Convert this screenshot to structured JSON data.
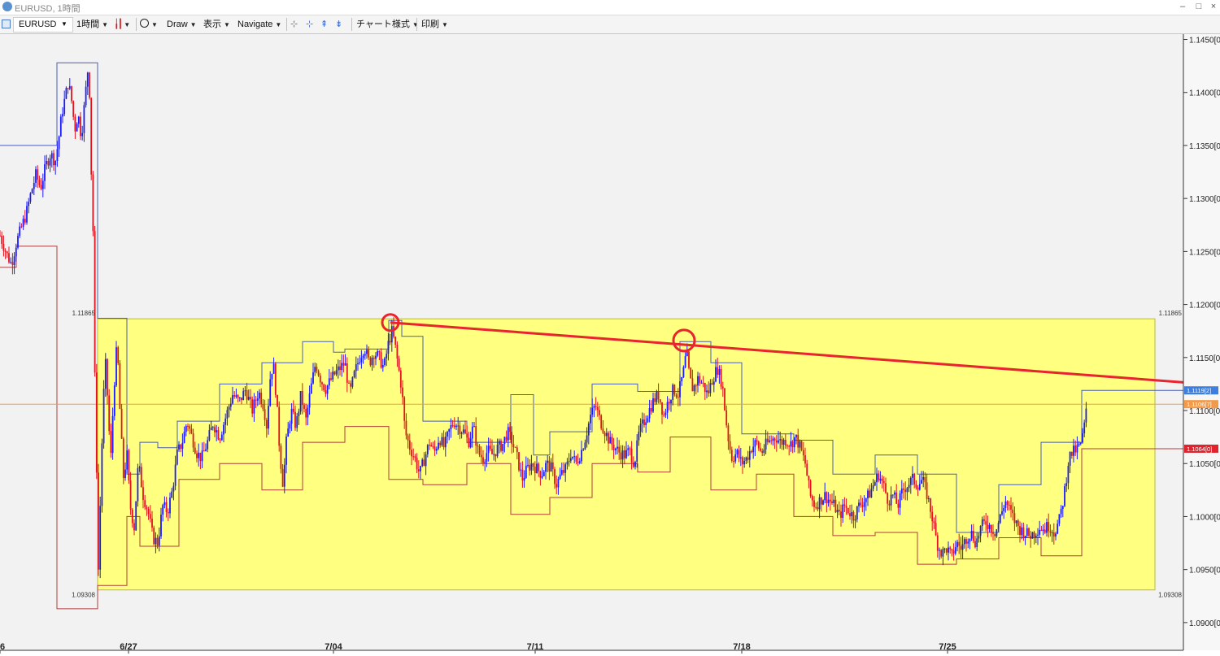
{
  "window": {
    "title": "EURUSD, 1時間"
  },
  "toolbar": {
    "symbol": "EURUSD",
    "timeframe": "1時間",
    "draw": "Draw",
    "display": "表示",
    "navigate": "Navigate",
    "chart_style": "チャート様式",
    "print": "印刷"
  },
  "colors": {
    "bull": "#1a1aff",
    "bear": "#e0141e",
    "range_box": "#ffff80",
    "trendline": "#e8242e",
    "current_price_line": "#f29a4a",
    "tag_blue": "#3d7fe0",
    "tag_orange": "#f29a4a",
    "tag_red": "#e0232d"
  },
  "chart_data": {
    "type": "candlestick",
    "symbol": "EURUSD",
    "timeframe": "1時間",
    "ylim": [
      1.0893,
      1.1455
    ],
    "y_ticks": [
      "1.1450[0]",
      "1.1400[0]",
      "1.1350[0]",
      "1.1300[0]",
      "1.1250[0]",
      "1.1200[0]",
      "1.1150[0]",
      "1.1100[0]",
      "1.1050[0]",
      "1.1000[0]",
      "1.0950[0]",
      "1.0900[0]"
    ],
    "x_ticks": [
      "6",
      "6/27",
      "7/04",
      "7/11",
      "7/18",
      "7/25"
    ],
    "range_box": {
      "upper": 1.11865,
      "lower": 1.09308,
      "upper_label": "1.11865",
      "lower_label": "1.09308"
    },
    "price_tags": [
      {
        "label": "1.1119[2]",
        "value": 1.1119,
        "color": "blue"
      },
      {
        "label": "1.1106[7]",
        "value": 1.1106,
        "color": "orange"
      },
      {
        "label": "1.1064[0]",
        "value": 1.1064,
        "color": "red"
      }
    ],
    "trendline": {
      "from": {
        "date": "7/06",
        "price": 1.1183
      },
      "to": {
        "date": "7/29",
        "price": 1.1124
      }
    },
    "circled_highs": [
      {
        "date": "7/06",
        "price": 1.1183
      },
      {
        "date": "7/15",
        "price": 1.1166
      }
    ],
    "current_price": 1.1106,
    "path": [
      [
        0,
        1.1265
      ],
      [
        8,
        1.1248
      ],
      [
        14,
        1.1238
      ],
      [
        20,
        1.1258
      ],
      [
        26,
        1.1272
      ],
      [
        32,
        1.1285
      ],
      [
        38,
        1.1305
      ],
      [
        44,
        1.1322
      ],
      [
        50,
        1.131
      ],
      [
        56,
        1.133
      ],
      [
        62,
        1.1342
      ],
      [
        68,
        1.1335
      ],
      [
        72,
        1.1355
      ],
      [
        76,
        1.138
      ],
      [
        80,
        1.1395
      ],
      [
        84,
        1.141
      ],
      [
        88,
        1.1392
      ],
      [
        92,
        1.1365
      ],
      [
        96,
        1.138
      ],
      [
        100,
        1.1358
      ],
      [
        104,
        1.139
      ],
      [
        108,
        1.1422
      ],
      [
        110,
        1.14
      ],
      [
        112,
        1.133
      ],
      [
        115,
        1.1255
      ],
      [
        117,
        1.11
      ],
      [
        119,
        1.104
      ],
      [
        121,
        1.095
      ],
      [
        123,
        1.1005
      ],
      [
        125,
        1.106
      ],
      [
        127,
        1.111
      ],
      [
        130,
        1.1145
      ],
      [
        133,
        1.11
      ],
      [
        136,
        1.105
      ],
      [
        140,
        1.112
      ],
      [
        144,
        1.1165
      ],
      [
        148,
        1.109
      ],
      [
        152,
        1.1035
      ],
      [
        156,
        1.106
      ],
      [
        160,
        1.101
      ],
      [
        165,
        1.099
      ],
      [
        170,
        1.105
      ],
      [
        176,
        1.102
      ],
      [
        182,
        1.1005
      ],
      [
        188,
        1.098
      ],
      [
        194,
        1.0975
      ],
      [
        200,
        1.101
      ],
      [
        206,
        1.1005
      ],
      [
        212,
        1.1025
      ],
      [
        218,
        1.106
      ],
      [
        224,
        1.107
      ],
      [
        230,
        1.109
      ],
      [
        236,
        1.1075
      ],
      [
        242,
        1.106
      ],
      [
        248,
        1.1055
      ],
      [
        255,
        1.107
      ],
      [
        262,
        1.1088
      ],
      [
        270,
        1.1075
      ],
      [
        278,
        1.1095
      ],
      [
        286,
        1.1115
      ],
      [
        294,
        1.1108
      ],
      [
        302,
        1.112
      ],
      [
        310,
        1.11
      ],
      [
        318,
        1.1118
      ],
      [
        324,
        1.1105
      ],
      [
        328,
        1.1085
      ],
      [
        332,
        1.113
      ],
      [
        336,
        1.1145
      ],
      [
        340,
        1.111
      ],
      [
        344,
        1.106
      ],
      [
        348,
        1.103
      ],
      [
        352,
        1.107
      ],
      [
        358,
        1.11
      ],
      [
        364,
        1.1085
      ],
      [
        370,
        1.1115
      ],
      [
        376,
        1.109
      ],
      [
        382,
        1.112
      ],
      [
        388,
        1.1145
      ],
      [
        394,
        1.113
      ],
      [
        400,
        1.112
      ],
      [
        406,
        1.1128
      ],
      [
        412,
        1.1135
      ],
      [
        418,
        1.114
      ],
      [
        424,
        1.1145
      ],
      [
        430,
        1.1115
      ],
      [
        436,
        1.1135
      ],
      [
        442,
        1.115
      ],
      [
        448,
        1.116
      ],
      [
        454,
        1.1145
      ],
      [
        460,
        1.1155
      ],
      [
        466,
        1.115
      ],
      [
        472,
        1.114
      ],
      [
        478,
        1.1165
      ],
      [
        482,
        1.1175
      ],
      [
        486,
        1.116
      ],
      [
        490,
        1.114
      ],
      [
        494,
        1.112
      ],
      [
        498,
        1.108
      ],
      [
        504,
        1.1065
      ],
      [
        510,
        1.1055
      ],
      [
        516,
        1.104
      ],
      [
        522,
        1.1055
      ],
      [
        528,
        1.107
      ],
      [
        534,
        1.106
      ],
      [
        540,
        1.1075
      ],
      [
        546,
        1.1065
      ],
      [
        552,
        1.108
      ],
      [
        558,
        1.109
      ],
      [
        564,
        1.1085
      ],
      [
        570,
        1.108
      ],
      [
        576,
        1.107
      ],
      [
        582,
        1.1085
      ],
      [
        588,
        1.106
      ],
      [
        594,
        1.1055
      ],
      [
        600,
        1.1062
      ],
      [
        606,
        1.1058
      ],
      [
        612,
        1.1065
      ],
      [
        618,
        1.1068
      ],
      [
        624,
        1.108
      ],
      [
        630,
        1.107
      ],
      [
        636,
        1.1055
      ],
      [
        642,
        1.1035
      ],
      [
        648,
        1.1045
      ],
      [
        654,
        1.105
      ],
      [
        660,
        1.1045
      ],
      [
        666,
        1.104
      ],
      [
        672,
        1.105
      ],
      [
        678,
        1.1045
      ],
      [
        684,
        1.103
      ],
      [
        690,
        1.104
      ],
      [
        696,
        1.1045
      ],
      [
        702,
        1.106
      ],
      [
        708,
        1.105
      ],
      [
        714,
        1.106
      ],
      [
        720,
        1.1075
      ],
      [
        726,
        1.1095
      ],
      [
        732,
        1.1105
      ],
      [
        738,
        1.109
      ],
      [
        744,
        1.108
      ],
      [
        750,
        1.107
      ],
      [
        756,
        1.1065
      ],
      [
        762,
        1.106
      ],
      [
        768,
        1.1058
      ],
      [
        774,
        1.1062
      ],
      [
        780,
        1.105
      ],
      [
        786,
        1.108
      ],
      [
        792,
        1.109
      ],
      [
        798,
        1.11
      ],
      [
        804,
        1.111
      ],
      [
        810,
        1.1115
      ],
      [
        816,
        1.1095
      ],
      [
        822,
        1.111
      ],
      [
        828,
        1.112
      ],
      [
        834,
        1.1115
      ],
      [
        840,
        1.1135
      ],
      [
        844,
        1.1155
      ],
      [
        848,
        1.113
      ],
      [
        852,
        1.112
      ],
      [
        858,
        1.113
      ],
      [
        864,
        1.1125
      ],
      [
        870,
        1.1115
      ],
      [
        876,
        1.113
      ],
      [
        882,
        1.114
      ],
      [
        888,
        1.1125
      ],
      [
        892,
        1.1095
      ],
      [
        896,
        1.107
      ],
      [
        900,
        1.1055
      ],
      [
        906,
        1.106
      ],
      [
        912,
        1.105
      ],
      [
        918,
        1.1055
      ],
      [
        924,
        1.1065
      ],
      [
        930,
        1.107
      ],
      [
        936,
        1.106
      ],
      [
        942,
        1.1068
      ],
      [
        948,
        1.1072
      ],
      [
        954,
        1.1075
      ],
      [
        960,
        1.107
      ],
      [
        966,
        1.1072
      ],
      [
        972,
        1.1068
      ],
      [
        978,
        1.1075
      ],
      [
        984,
        1.1065
      ],
      [
        990,
        1.105
      ],
      [
        996,
        1.102
      ],
      [
        1002,
        1.101
      ],
      [
        1008,
        1.1015
      ],
      [
        1014,
        1.102
      ],
      [
        1020,
        1.1015
      ],
      [
        1026,
        1.101
      ],
      [
        1032,
        1.1
      ],
      [
        1038,
        1.101
      ],
      [
        1044,
        1.1005
      ],
      [
        1050,
        1.1
      ],
      [
        1056,
        1.101
      ],
      [
        1062,
        1.1015
      ],
      [
        1068,
        1.102
      ],
      [
        1074,
        1.103
      ],
      [
        1080,
        1.104
      ],
      [
        1086,
        1.103
      ],
      [
        1092,
        1.1015
      ],
      [
        1098,
        1.102
      ],
      [
        1104,
        1.101
      ],
      [
        1110,
        1.1025
      ],
      [
        1116,
        1.103
      ],
      [
        1122,
        1.1035
      ],
      [
        1128,
        1.103
      ],
      [
        1134,
        1.1035
      ],
      [
        1140,
        1.102
      ],
      [
        1146,
        1.1
      ],
      [
        1152,
        1.0975
      ],
      [
        1158,
        1.0965
      ],
      [
        1164,
        1.097
      ],
      [
        1170,
        1.0962
      ],
      [
        1176,
        1.0975
      ],
      [
        1182,
        1.097
      ],
      [
        1188,
        1.098
      ],
      [
        1194,
        1.0985
      ],
      [
        1200,
        1.0975
      ],
      [
        1206,
        1.099
      ],
      [
        1212,
        1.0995
      ],
      [
        1218,
        1.099
      ],
      [
        1224,
        1.0985
      ],
      [
        1230,
        1.1
      ],
      [
        1236,
        1.1015
      ],
      [
        1242,
        1.1005
      ],
      [
        1248,
        1.0995
      ],
      [
        1254,
        1.0988
      ],
      [
        1260,
        1.0985
      ],
      [
        1266,
        1.0982
      ],
      [
        1272,
        1.0985
      ],
      [
        1278,
        1.099
      ],
      [
        1284,
        1.0988
      ],
      [
        1290,
        1.0992
      ],
      [
        1296,
        1.0985
      ],
      [
        1302,
        1.0995
      ],
      [
        1306,
        1.101
      ],
      [
        1310,
        1.103
      ],
      [
        1314,
        1.1055
      ],
      [
        1318,
        1.106
      ],
      [
        1322,
        1.1062
      ],
      [
        1326,
        1.1065
      ],
      [
        1330,
        1.107
      ],
      [
        1334,
        1.109
      ],
      [
        1337,
        1.1107
      ]
    ],
    "channel": {
      "blue_upper": [
        [
          0,
          1.135
        ],
        [
          70,
          1.135
        ],
        [
          70,
          1.1428
        ],
        [
          120,
          1.1428
        ],
        [
          120,
          1.1187
        ],
        [
          156,
          1.1187
        ],
        [
          156,
          1.104
        ],
        [
          172,
          1.104
        ],
        [
          172,
          1.107
        ],
        [
          194,
          1.107
        ],
        [
          194,
          1.1065
        ],
        [
          218,
          1.1065
        ],
        [
          218,
          1.109
        ],
        [
          270,
          1.109
        ],
        [
          270,
          1.1125
        ],
        [
          322,
          1.1125
        ],
        [
          322,
          1.1145
        ],
        [
          372,
          1.1145
        ],
        [
          372,
          1.1165
        ],
        [
          410,
          1.1165
        ],
        [
          410,
          1.1155
        ],
        [
          424,
          1.1155
        ],
        [
          424,
          1.1158
        ],
        [
          478,
          1.1158
        ],
        [
          478,
          1.1185
        ],
        [
          494,
          1.1185
        ],
        [
          494,
          1.117
        ],
        [
          520,
          1.117
        ],
        [
          520,
          1.109
        ],
        [
          574,
          1.109
        ],
        [
          574,
          1.107
        ],
        [
          628,
          1.107
        ],
        [
          628,
          1.1115
        ],
        [
          656,
          1.1115
        ],
        [
          656,
          1.1058
        ],
        [
          676,
          1.1058
        ],
        [
          676,
          1.108
        ],
        [
          728,
          1.108
        ],
        [
          728,
          1.1125
        ],
        [
          784,
          1.1125
        ],
        [
          784,
          1.1118
        ],
        [
          836,
          1.1118
        ],
        [
          836,
          1.1165
        ],
        [
          874,
          1.1165
        ],
        [
          874,
          1.1145
        ],
        [
          912,
          1.1145
        ],
        [
          912,
          1.1078
        ],
        [
          976,
          1.1078
        ],
        [
          976,
          1.1072
        ],
        [
          1024,
          1.1072
        ],
        [
          1024,
          1.104
        ],
        [
          1076,
          1.104
        ],
        [
          1076,
          1.1058
        ],
        [
          1128,
          1.1058
        ],
        [
          1128,
          1.104
        ],
        [
          1176,
          1.104
        ],
        [
          1176,
          1.0985
        ],
        [
          1228,
          1.0985
        ],
        [
          1228,
          1.103
        ],
        [
          1280,
          1.103
        ],
        [
          1280,
          1.107
        ],
        [
          1330,
          1.107
        ],
        [
          1330,
          1.1119
        ],
        [
          1455,
          1.1119
        ]
      ],
      "red_lower": [
        [
          0,
          1.1235
        ],
        [
          20,
          1.1235
        ],
        [
          20,
          1.1255
        ],
        [
          70,
          1.1255
        ],
        [
          70,
          1.0913
        ],
        [
          120,
          1.0913
        ],
        [
          120,
          1.0935
        ],
        [
          156,
          1.0935
        ],
        [
          156,
          1.1
        ],
        [
          172,
          1.1
        ],
        [
          172,
          1.0972
        ],
        [
          220,
          1.0972
        ],
        [
          220,
          1.1035
        ],
        [
          270,
          1.1035
        ],
        [
          270,
          1.105
        ],
        [
          322,
          1.105
        ],
        [
          322,
          1.1025
        ],
        [
          372,
          1.1025
        ],
        [
          372,
          1.107
        ],
        [
          424,
          1.107
        ],
        [
          424,
          1.1085
        ],
        [
          478,
          1.1085
        ],
        [
          478,
          1.1035
        ],
        [
          520,
          1.1035
        ],
        [
          520,
          1.103
        ],
        [
          574,
          1.103
        ],
        [
          574,
          1.105
        ],
        [
          628,
          1.105
        ],
        [
          628,
          1.1002
        ],
        [
          676,
          1.1002
        ],
        [
          676,
          1.1018
        ],
        [
          728,
          1.1018
        ],
        [
          728,
          1.105
        ],
        [
          784,
          1.105
        ],
        [
          784,
          1.1042
        ],
        [
          824,
          1.1042
        ],
        [
          824,
          1.1075
        ],
        [
          874,
          1.1075
        ],
        [
          874,
          1.1025
        ],
        [
          930,
          1.1025
        ],
        [
          930,
          1.104
        ],
        [
          976,
          1.104
        ],
        [
          976,
          1.1
        ],
        [
          1024,
          1.1
        ],
        [
          1024,
          1.0982
        ],
        [
          1076,
          1.0982
        ],
        [
          1076,
          1.0985
        ],
        [
          1128,
          1.0985
        ],
        [
          1128,
          1.0955
        ],
        [
          1176,
          1.0955
        ],
        [
          1176,
          1.096
        ],
        [
          1228,
          1.096
        ],
        [
          1228,
          1.098
        ],
        [
          1280,
          1.098
        ],
        [
          1280,
          1.0963
        ],
        [
          1330,
          1.0963
        ],
        [
          1330,
          1.1064
        ],
        [
          1455,
          1.1064
        ]
      ]
    }
  }
}
